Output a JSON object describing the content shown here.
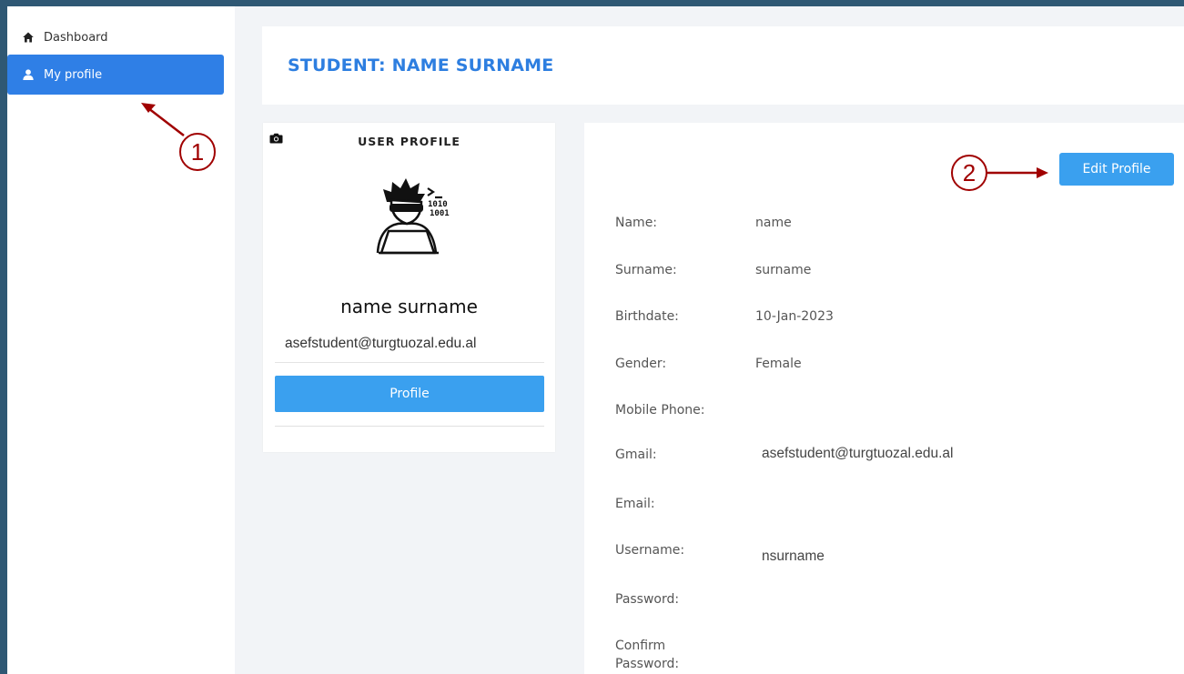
{
  "sidebar": {
    "items": [
      {
        "label": "Dashboard",
        "icon": "home-icon"
      },
      {
        "label": "My profile",
        "icon": "user-icon",
        "active": true
      }
    ]
  },
  "header": {
    "title": "STUDENT: NAME SURNAME"
  },
  "profile_card": {
    "title": "USER PROFILE",
    "name": "name surname",
    "email": "asefstudent@turgtuozal.edu.al",
    "button_label": "Profile"
  },
  "details": {
    "edit_button": "Edit Profile",
    "fields": [
      {
        "label": "Name:",
        "value": "name"
      },
      {
        "label": "Surname:",
        "value": "surname"
      },
      {
        "label": "Birthdate:",
        "value": "10-Jan-2023"
      },
      {
        "label": "Gender:",
        "value": "Female"
      },
      {
        "label": "Mobile Phone:",
        "value": ""
      },
      {
        "label": "Gmail:",
        "value": "asefstudent@turgtuozal.edu.al"
      },
      {
        "label": "Email:",
        "value": ""
      },
      {
        "label": "Username:",
        "value": "nsurname"
      },
      {
        "label": "Password:",
        "value": ""
      },
      {
        "label": "Confirm Password:",
        "value": ""
      }
    ]
  },
  "annotations": [
    {
      "number": "1",
      "target": "My profile"
    },
    {
      "number": "2",
      "target": "Edit Profile"
    }
  ],
  "colors": {
    "accent": "#2f7fe6",
    "button": "#3aa0ef",
    "frame": "#2f5874",
    "annotation": "#a00000"
  }
}
